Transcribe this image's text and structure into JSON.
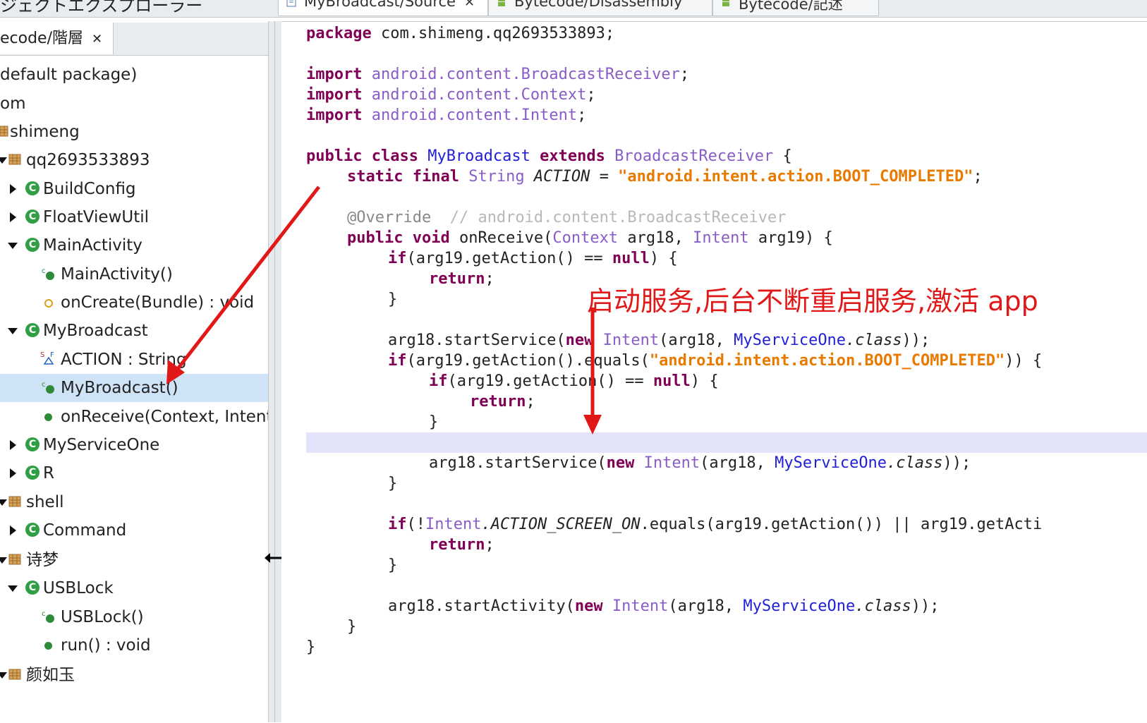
{
  "window": {
    "title": "ジェクトエクスプローラー",
    "tabs": [
      {
        "label": "MyBroadcast/Source",
        "close": "✕"
      },
      {
        "label": "Bytecode/Disassembly"
      },
      {
        "label": "Bytecode/記述"
      }
    ]
  },
  "left_panel": {
    "tab_label": "ecode/階層",
    "tab_close": "✕"
  },
  "tree": [
    {
      "label": "default package)",
      "kind": "text"
    },
    {
      "label": "om",
      "kind": "text"
    },
    {
      "label": "shimeng",
      "kind": "package"
    },
    {
      "label": "qq2693533893",
      "kind": "package"
    },
    {
      "label": "BuildConfig",
      "kind": "class",
      "expanded": false
    },
    {
      "label": "FloatViewUtil",
      "kind": "class",
      "expanded": false
    },
    {
      "label": "MainActivity",
      "kind": "class",
      "expanded": true
    },
    {
      "label": "MainActivity()",
      "kind": "constructor"
    },
    {
      "label": "onCreate(Bundle) : void",
      "kind": "method-protected"
    },
    {
      "label": "MyBroadcast",
      "kind": "class",
      "expanded": true
    },
    {
      "label": "ACTION : String",
      "kind": "field"
    },
    {
      "label": "MyBroadcast()",
      "kind": "constructor",
      "selected": true
    },
    {
      "label": "onReceive(Context, Intent) :",
      "kind": "method"
    },
    {
      "label": "MyServiceOne",
      "kind": "class",
      "expanded": false
    },
    {
      "label": "R",
      "kind": "class",
      "expanded": false
    },
    {
      "label": "shell",
      "kind": "package"
    },
    {
      "label": "Command",
      "kind": "class",
      "expanded": false
    },
    {
      "label": "诗梦",
      "kind": "package"
    },
    {
      "label": "USBLock",
      "kind": "class",
      "expanded": true
    },
    {
      "label": "USBLock()",
      "kind": "constructor"
    },
    {
      "label": "run() : void",
      "kind": "method"
    },
    {
      "label": "颜如玉",
      "kind": "package"
    }
  ],
  "code": {
    "l01_kw": "package",
    "l01_rest": " com.shimeng.qq2693533893;",
    "imp_kw": "import",
    "l03_path": " android.content.BroadcastReceiver",
    "l04_path": " android.content.Context",
    "l05_path": " android.content.Intent",
    "semi": ";",
    "l07_kw": "public class",
    "l07_name": " MyBroadcast",
    "l07_ext": " extends",
    "l07_type": " BroadcastReceiver",
    "l07_end": " {",
    "l08_kw": "static final",
    "l08_type": " String",
    "l08_name": " ACTION",
    "l08_eq": " = ",
    "l08_str": "\"android.intent.action.BOOT_COMPLETED\"",
    "l10_ann": "@Override",
    "l10_cm": "  // android.content.BroadcastReceiver",
    "l11_kw": "public void",
    "l11_a": " onReceive(",
    "l11_t1": "Context",
    "l11_b": " arg18, ",
    "l11_t2": "Intent",
    "l11_c": " arg19) {",
    "l12_kw": "if",
    "l12_a": "(arg19.getAction() == ",
    "l12_null": "null",
    "l12_b": ") {",
    "ret_kw": "return",
    "close": "}",
    "l16_a": "arg18.startService(",
    "new_kw": "new",
    "intent_t": " Intent",
    "l16_b": "(arg18, ",
    "svc": "MyServiceOne",
    "cls_kw": ".class",
    "l16_c": "));",
    "l17_a": "(arg19.getAction().equals(",
    "l17_str": "\"android.intent.action.BOOT_COMPLETED\"",
    "l17_b": ")) {",
    "l24_a": "(!",
    "l24_t": "Intent",
    "l24_const": ".ACTION_SCREEN_ON",
    "l24_b": ".equals(arg19.getAction()) || arg19.getActi",
    "l28_a": "arg18.startActivity("
  },
  "annotation": {
    "text": "启动服务,后台不断重启服务,激活 app",
    "color": "#e01818"
  },
  "colors": {
    "keyword": "#7f0055",
    "type": "#8a5cc7",
    "string": "#e87a00",
    "selection": "#cfe3f7",
    "current_line": "#e3e4fa"
  }
}
